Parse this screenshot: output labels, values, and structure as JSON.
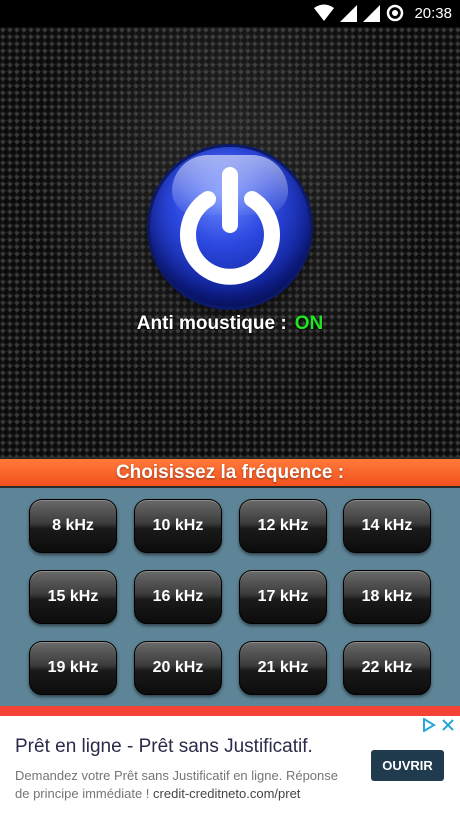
{
  "statusbar": {
    "time": "20:38"
  },
  "main": {
    "status_label": "Anti moustique :",
    "status_value": "ON",
    "status_color": "#22e622"
  },
  "frequency": {
    "title": "Choisissez la fréquence :",
    "buttons": [
      "8 kHz",
      "10 kHz",
      "12 kHz",
      "14 kHz",
      "15 kHz",
      "16 kHz",
      "17 kHz",
      "18 kHz",
      "19 kHz",
      "20 kHz",
      "21 kHz",
      "22 kHz"
    ]
  },
  "ad": {
    "title": "Prêt en ligne - Prêt sans Justificatif.",
    "description": "Demandez votre Prêt sans Justificatif en ligne. Réponse de principe immédiate !",
    "url": "credit-creditneto.com/pret",
    "cta": "OUVRIR"
  },
  "colors": {
    "banner": "#f4511e",
    "grid_bg": "#5e8597",
    "power_blue": "#2c48e0"
  },
  "icons": [
    "wifi-icon",
    "signal-icon",
    "signal-icon-2",
    "sync-icon",
    "power-icon",
    "adchoices-icon",
    "close-icon"
  ]
}
